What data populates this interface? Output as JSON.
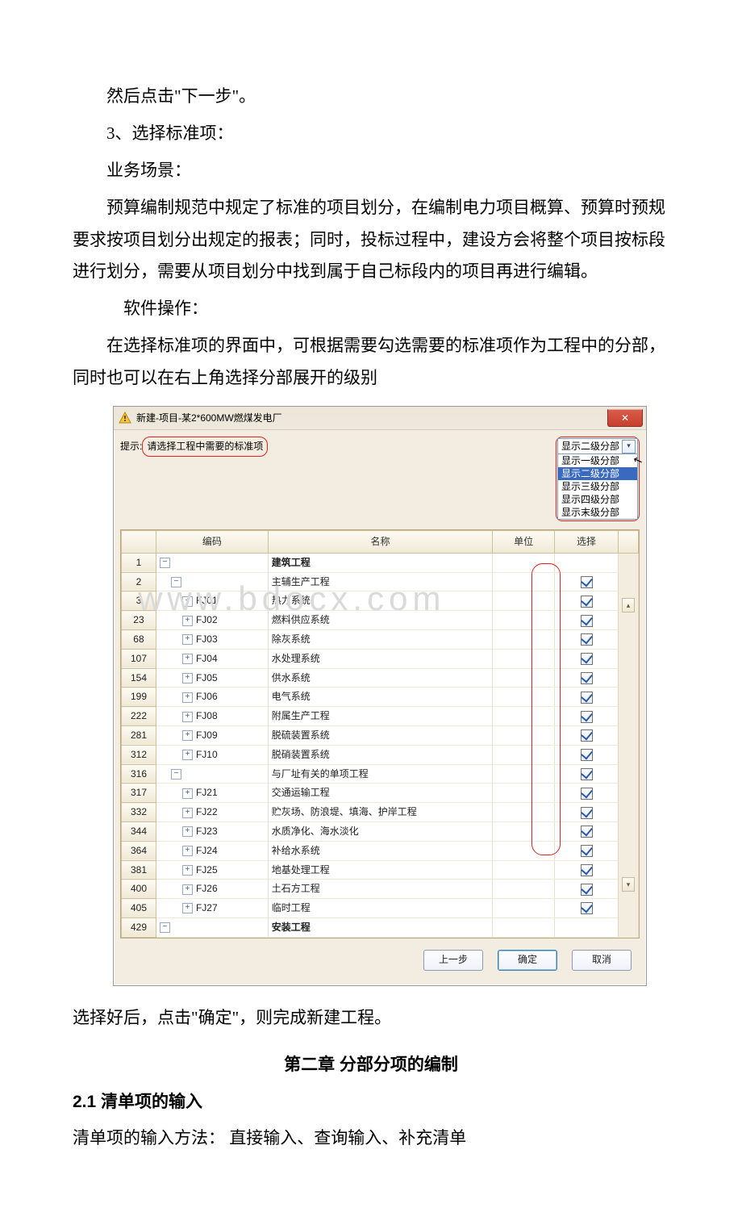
{
  "doc": {
    "p1": "然后点击\"下一步\"。",
    "p2": "3、选择标准项：",
    "p3": "业务场景：",
    "p4": "预算编制规范中规定了标准的项目划分，在编制电力项目概算、预算时预规要求按项目划分出规定的报表；同时，投标过程中，建设方会将整个项目按标段进行划分，需要从项目划分中找到属于自己标段内的项目再进行编辑。",
    "p5": "软件操作：",
    "p6": "在选择标准项的界面中，可根据需要勾选需要的标准项作为工程中的分部，同时也可以在右上角选择分部展开的级别",
    "p7": "选择好后，点击\"确定\"，则完成新建工程。",
    "chapter": "第二章 分部分项的编制",
    "section": "2.1 清单项的输入",
    "p8": "清单项的输入方法： 直接输入、查询输入、补充清单"
  },
  "win": {
    "title": "新建-项目-某2*600MW燃煤发电厂",
    "prompt_label": "提示:",
    "prompt_text": "请选择工程中需要的标准项",
    "dropdown_selected": "显示二级分部",
    "dropdown_options": [
      "显示一级分部",
      "显示二级分部",
      "显示三级分部",
      "显示四级分部",
      "显示末级分部"
    ],
    "columns": {
      "code": "编码",
      "name": "名称",
      "unit": "单位",
      "select": "选择"
    },
    "buttons": {
      "prev": "上一步",
      "ok": "确定",
      "cancel": "取消"
    },
    "watermark": "www.bdocx.com",
    "rows": [
      {
        "num": "1",
        "indent": 0,
        "exp": "-",
        "code": "",
        "name": "建筑工程",
        "bold": true,
        "chk": null
      },
      {
        "num": "2",
        "indent": 1,
        "exp": "-",
        "code": "",
        "name": "主辅生产工程",
        "bold": false,
        "chk": true
      },
      {
        "num": "3",
        "indent": 2,
        "exp": "+",
        "code": "FJ01",
        "name": "热力系统",
        "bold": false,
        "chk": true
      },
      {
        "num": "23",
        "indent": 2,
        "exp": "+",
        "code": "FJ02",
        "name": "燃料供应系统",
        "bold": false,
        "chk": true
      },
      {
        "num": "68",
        "indent": 2,
        "exp": "+",
        "code": "FJ03",
        "name": "除灰系统",
        "bold": false,
        "chk": true
      },
      {
        "num": "107",
        "indent": 2,
        "exp": "+",
        "code": "FJ04",
        "name": "水处理系统",
        "bold": false,
        "chk": true
      },
      {
        "num": "154",
        "indent": 2,
        "exp": "+",
        "code": "FJ05",
        "name": "供水系统",
        "bold": false,
        "chk": true
      },
      {
        "num": "199",
        "indent": 2,
        "exp": "+",
        "code": "FJ06",
        "name": "电气系统",
        "bold": false,
        "chk": true
      },
      {
        "num": "222",
        "indent": 2,
        "exp": "+",
        "code": "FJ08",
        "name": "附属生产工程",
        "bold": false,
        "chk": true
      },
      {
        "num": "281",
        "indent": 2,
        "exp": "+",
        "code": "FJ09",
        "name": "脱硫装置系统",
        "bold": false,
        "chk": true
      },
      {
        "num": "312",
        "indent": 2,
        "exp": "+",
        "code": "FJ10",
        "name": "脱硝装置系统",
        "bold": false,
        "chk": true
      },
      {
        "num": "316",
        "indent": 1,
        "exp": "-",
        "code": "",
        "name": "与厂址有关的单项工程",
        "bold": false,
        "chk": true
      },
      {
        "num": "317",
        "indent": 2,
        "exp": "+",
        "code": "FJ21",
        "name": "交通运输工程",
        "bold": false,
        "chk": true
      },
      {
        "num": "332",
        "indent": 2,
        "exp": "+",
        "code": "FJ22",
        "name": "贮灰场、防浪堤、填海、护岸工程",
        "bold": false,
        "chk": true
      },
      {
        "num": "344",
        "indent": 2,
        "exp": "+",
        "code": "FJ23",
        "name": "水质净化、海水淡化",
        "bold": false,
        "chk": true
      },
      {
        "num": "364",
        "indent": 2,
        "exp": "+",
        "code": "FJ24",
        "name": "补给水系统",
        "bold": false,
        "chk": true
      },
      {
        "num": "381",
        "indent": 2,
        "exp": "+",
        "code": "FJ25",
        "name": "地基处理工程",
        "bold": false,
        "chk": true
      },
      {
        "num": "400",
        "indent": 2,
        "exp": "+",
        "code": "FJ26",
        "name": "土石方工程",
        "bold": false,
        "chk": true
      },
      {
        "num": "405",
        "indent": 2,
        "exp": "+",
        "code": "FJ27",
        "name": "临时工程",
        "bold": false,
        "chk": true
      },
      {
        "num": "429",
        "indent": 0,
        "exp": "-",
        "code": "",
        "name": "安装工程",
        "bold": true,
        "chk": null
      }
    ]
  }
}
